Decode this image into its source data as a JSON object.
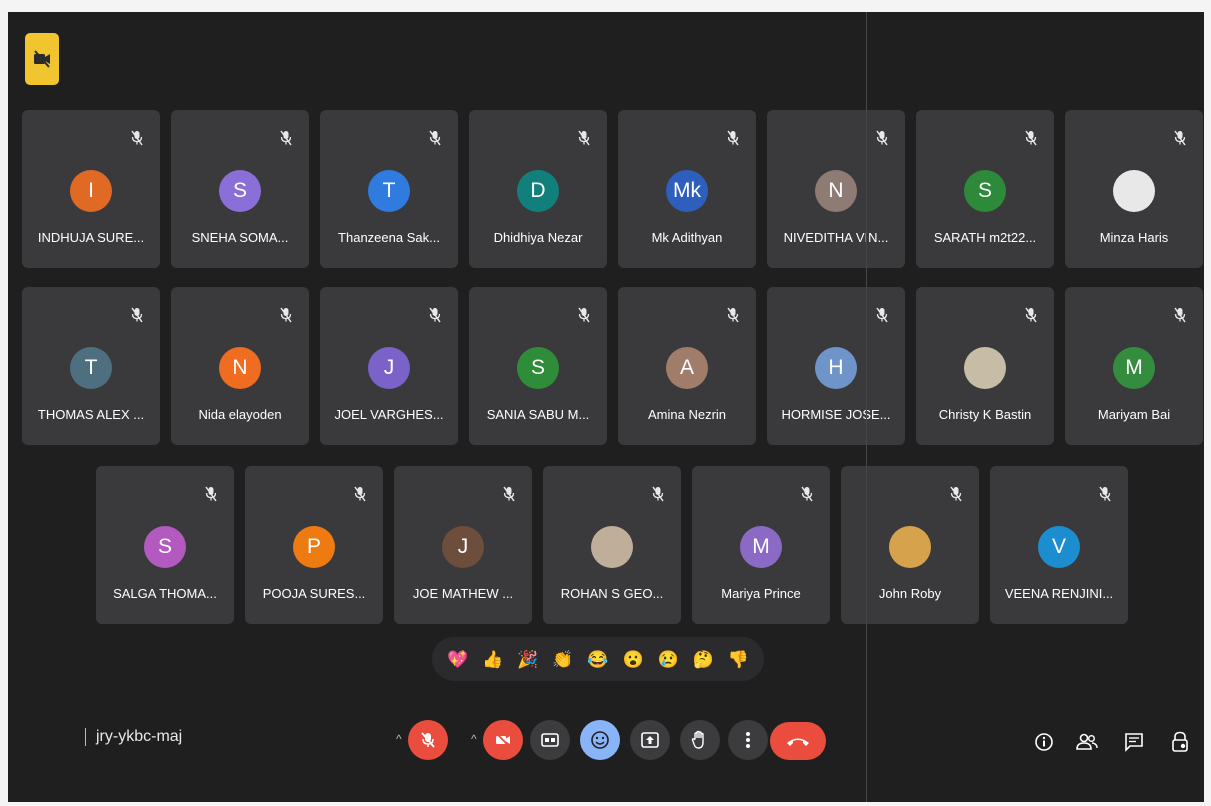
{
  "participants": [
    {
      "name": "INDHUJA SURE...",
      "initial": "I",
      "color": "#e06a24"
    },
    {
      "name": "SNEHA SOMA...",
      "initial": "S",
      "color": "#8a6fd8"
    },
    {
      "name": "Thanzeena Sak...",
      "initial": "T",
      "color": "#2f7be0"
    },
    {
      "name": "Dhidhiya Nezar",
      "initial": "D",
      "color": "#11807d"
    },
    {
      "name": "Mk Adithyan",
      "initial": "Mk",
      "color": "#2f5fbd"
    },
    {
      "name": "NIVEDITHA VIN...",
      "initial": "N",
      "color": "#8d7b74"
    },
    {
      "name": "SARATH m2t22...",
      "initial": "S",
      "color": "#2d8a3a"
    },
    {
      "name": "Minza Haris",
      "initial": "",
      "color": "#e8e8e8"
    },
    {
      "name": "THOMAS ALEX ...",
      "initial": "T",
      "color": "#4e6f80"
    },
    {
      "name": "Nida elayoden",
      "initial": "N",
      "color": "#ef6c21"
    },
    {
      "name": "JOEL VARGHES...",
      "initial": "J",
      "color": "#7b62c8"
    },
    {
      "name": "SANIA SABU M...",
      "initial": "S",
      "color": "#2f8c39"
    },
    {
      "name": "Amina Nezrin",
      "initial": "A",
      "color": "#a07c6a"
    },
    {
      "name": "HORMISE JOSE...",
      "initial": "H",
      "color": "#6f94c9"
    },
    {
      "name": "Christy K Bastin",
      "initial": "",
      "color": "#c7bda6"
    },
    {
      "name": "Mariyam Bai",
      "initial": "M",
      "color": "#348c3e"
    },
    {
      "name": "SALGA THOMA...",
      "initial": "S",
      "color": "#b25ac0"
    },
    {
      "name": "POOJA SURES...",
      "initial": "P",
      "color": "#ee7a12"
    },
    {
      "name": "JOE MATHEW ...",
      "initial": "J",
      "color": "#6d4e3d"
    },
    {
      "name": "ROHAN S GEO...",
      "initial": "",
      "color": "#bfae9a"
    },
    {
      "name": "Mariya Prince",
      "initial": "M",
      "color": "#8b6ac6"
    },
    {
      "name": "John Roby",
      "initial": "",
      "color": "#d7a24c"
    },
    {
      "name": "VEENA RENJINI...",
      "initial": "V",
      "color": "#1c8ed0"
    }
  ],
  "reactions": [
    {
      "icon": "heart-icon",
      "glyph": "💖"
    },
    {
      "icon": "thumbs-up-icon",
      "glyph": "👍"
    },
    {
      "icon": "party-popper-icon",
      "glyph": "🎉"
    },
    {
      "icon": "clapping-hands-icon",
      "glyph": "👏"
    },
    {
      "icon": "laughing-face-icon",
      "glyph": "😂"
    },
    {
      "icon": "surprised-face-icon",
      "glyph": "😮"
    },
    {
      "icon": "sad-face-icon",
      "glyph": "😢"
    },
    {
      "icon": "thinking-face-icon",
      "glyph": "🤔"
    },
    {
      "icon": "thumbs-down-icon",
      "glyph": "👎"
    }
  ],
  "meeting": {
    "code": "jry-ykbc-maj"
  },
  "colors": {
    "background": "#1f1f20",
    "tile": "#3a3a3c",
    "muted_control": "#ea4d3d",
    "camera_off_badge": "#f0c52f",
    "active_control": "#8ab4f8"
  }
}
